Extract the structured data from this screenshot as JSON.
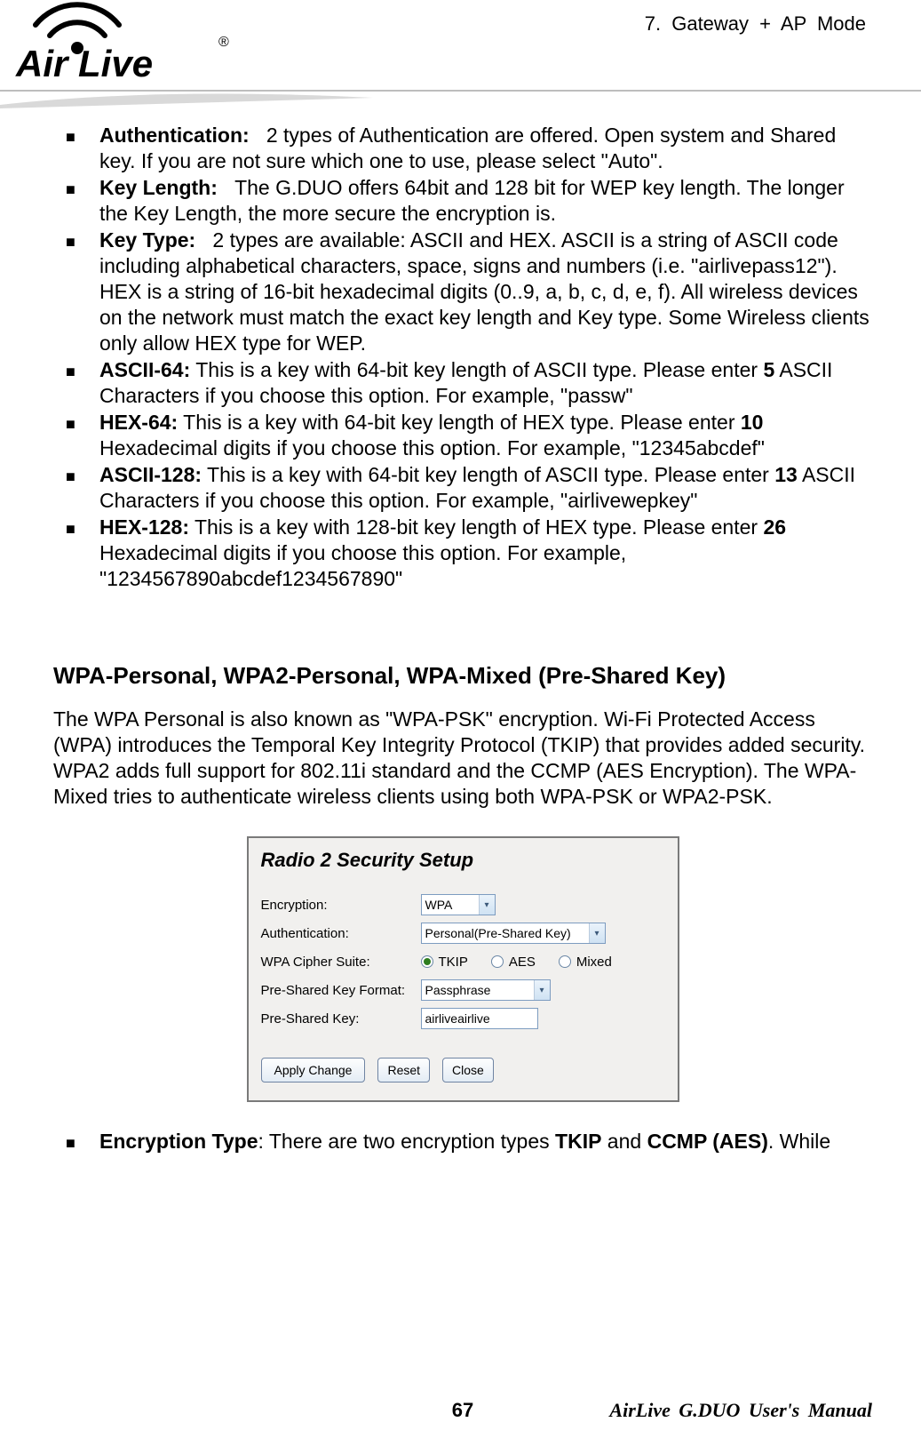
{
  "header": {
    "chapter": "7.  Gateway  +  AP    Mode"
  },
  "logo": {
    "text": "Air Live",
    "registered": "®"
  },
  "bullets_top": [
    {
      "label": "Authentication:",
      "text": "2 types of Authentication are offered.    Open system and Shared key.    If you are not sure which one to use, please select \"Auto\"."
    },
    {
      "label": "Key Length:",
      "text": "The G.DUO offers 64bit and 128 bit for WEP key length.    The longer the Key Length, the more secure the encryption is."
    },
    {
      "label": "Key Type:",
      "text": "2 types are available: ASCII and HEX.    ASCII is a string of ASCII code including alphabetical characters, space, signs and numbers (i.e. \"airlivepass12\").    HEX is a string of 16-bit hexadecimal digits (0..9, a, b, c, d, e, f). All wireless devices on the network must match the exact key length and Key type. Some Wireless clients only allow HEX type for WEP."
    },
    {
      "label": "ASCII-64:",
      "text_before_bold": " This is a key with 64-bit key length of ASCII type.    Please enter ",
      "bold_num": "5",
      "text_after_bold": " ASCII Characters if you choose this option. For example, \"passw\""
    },
    {
      "label": "HEX-64:",
      "text_before_bold": " This is a key with 64-bit key length of HEX type.    Please enter ",
      "bold_num": "10",
      "text_after_bold": " Hexadecimal digits if you choose this option. For example, \"12345abcdef\""
    },
    {
      "label": "ASCII-128:",
      "text_before_bold": " This is a key with 64-bit key length of ASCII type.    Please enter ",
      "bold_num": "13",
      "text_after_bold": " ASCII Characters if you choose this option. For example, \"airlivewepkey\""
    },
    {
      "label": "HEX-128:",
      "text_before_bold": " This is a key with 128-bit key length of HEX type.    Please enter ",
      "bold_num": "26",
      "text_after_bold": " Hexadecimal digits if you choose this option. For example, \"1234567890abcdef1234567890\""
    }
  ],
  "section_heading": "WPA-Personal, WPA2-Personal, WPA-Mixed (Pre-Shared Key)",
  "section_para": "The WPA Personal is also known as \"WPA-PSK\" encryption.    Wi-Fi Protected Access (WPA) introduces the Temporal Key Integrity Protocol (TKIP) that provides added security.    WPA2 adds full support for 802.11i standard and the CCMP (AES Encryption). The WPA-Mixed tries to authenticate wireless clients using both WPA-PSK or WPA2-PSK.",
  "panel": {
    "title": "Radio 2 Security Setup",
    "rows": {
      "encryption_label": "Encryption:",
      "encryption_value": "WPA",
      "auth_label": "Authentication:",
      "auth_value": "Personal(Pre-Shared Key)",
      "cipher_label": "WPA Cipher Suite:",
      "cipher_tkip": "TKIP",
      "cipher_aes": "AES",
      "cipher_mixed": "Mixed",
      "pskfmt_label": "Pre-Shared Key Format:",
      "pskfmt_value": "Passphrase",
      "psk_label": "Pre-Shared Key:",
      "psk_value": "airliveairlive"
    },
    "buttons": {
      "apply": "Apply Change",
      "reset": "Reset",
      "close": "Close"
    }
  },
  "bullets_bottom": [
    {
      "label": "Encryption Type",
      "colon": ":",
      "text_before_bold1": "   There are two encryption types ",
      "bold1": "TKIP",
      "mid": " and ",
      "bold2": "CCMP (AES)",
      "text_after": ". While"
    }
  ],
  "footer": {
    "page": "67",
    "manual": "AirLive  G.DUO  User's  Manual"
  }
}
